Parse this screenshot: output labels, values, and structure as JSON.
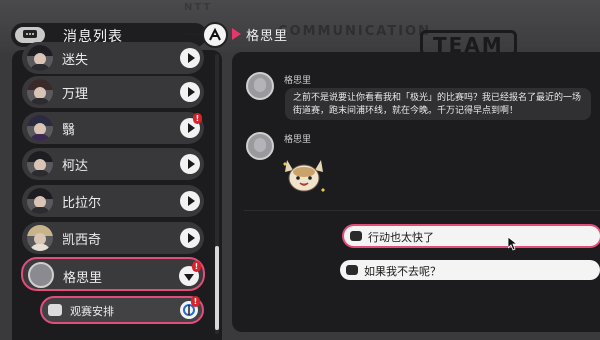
{
  "header": {
    "title": "消息列表",
    "current_chat_name": "格思里",
    "accent_color": "#e24d7a",
    "bg_words": [
      "NTT",
      "COMMUNICATION",
      "TEAM"
    ]
  },
  "contacts": [
    {
      "name": "迷失",
      "badge": ""
    },
    {
      "name": "万理",
      "badge": ""
    },
    {
      "name": "翳",
      "badge": "!"
    },
    {
      "name": "柯达",
      "badge": ""
    },
    {
      "name": "比拉尔",
      "badge": ""
    },
    {
      "name": "凯西奇",
      "badge": ""
    },
    {
      "name": "格思里",
      "badge": "!",
      "active": true
    }
  ],
  "sub_item": {
    "label": "观赛安排",
    "badge": "!"
  },
  "chat": {
    "messages": [
      {
        "sender": "格思里",
        "text": "之前不是说要让你看看我和「极光」的比赛吗？我已经报名了最近的一场街道赛，跑末间浦环线，就在今晚。千万记得早点到啊！"
      },
      {
        "sender": "格思里",
        "type": "sticker",
        "sticker": "excited-dog-sticker"
      }
    ],
    "choices": [
      {
        "text": "行动也太快了",
        "selected": true
      },
      {
        "text": "如果我不去呢？",
        "selected": false
      }
    ]
  }
}
